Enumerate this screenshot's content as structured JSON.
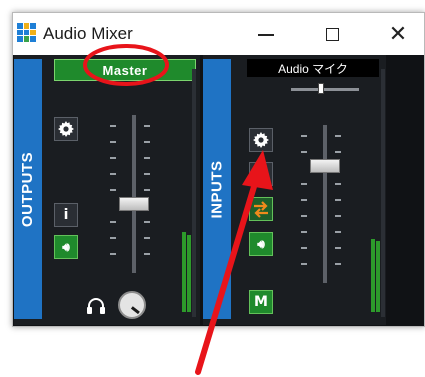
{
  "window": {
    "title": "Audio Mixer",
    "controls": {
      "close_glyph": "✕"
    }
  },
  "outputs": {
    "section_label": "OUTPUTS",
    "channel_label": "Master",
    "info_button": "i",
    "speaker_button": "🔊︎"
  },
  "inputs": {
    "section_label": "INPUTS",
    "channel_label": "Audio マイク",
    "solo_button": "S",
    "speaker_button": "🔊︎",
    "mute_button": "M"
  },
  "icons": {
    "settings": "gear-icon",
    "headphones": "headphones-icon",
    "routing": "routing-arrows-icon",
    "app": "audio-mixer-app-icon"
  },
  "colors": {
    "accent_blue": "#1f73c4",
    "channel_green": "#1f8a2c",
    "annotation_red": "#e8141a",
    "meter_green": "#2d9a2b"
  }
}
